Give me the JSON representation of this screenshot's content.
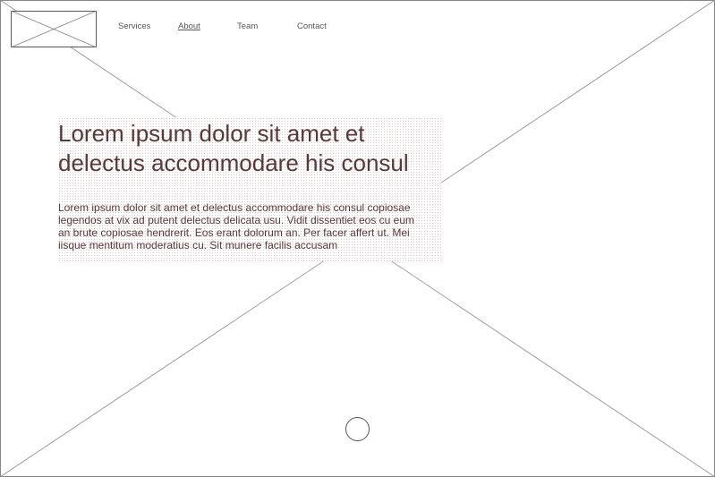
{
  "header": {
    "logo": {
      "icon": "image-placeholder-icon"
    },
    "nav": {
      "items": [
        {
          "label": "Services",
          "active": false
        },
        {
          "label": "About",
          "active": true
        },
        {
          "label": "Team",
          "active": false
        },
        {
          "label": "Contact",
          "active": false
        }
      ]
    }
  },
  "hero": {
    "background_icon": "image-placeholder-icon",
    "title": "Lorem ipsum dolor sit amet et delectus accommodare his consul",
    "body": "Lorem ipsum dolor sit amet et delectus accommodare his consul copiosae legendos at vix ad putent delectus delicata usu. Vidit dissentiet eos cu eum an brute copiosae hendrerit. Eos erant dolorum an. Per facer affert ut. Mei iisque mentitum moderatius cu. Sit munere facilis accusam"
  },
  "carousel": {
    "indicator_icon": "circle-icon"
  },
  "colors": {
    "line": "#888888",
    "text_nav": "#555555",
    "text_hero": "#5a3838",
    "hero_pattern": "#c89696"
  }
}
